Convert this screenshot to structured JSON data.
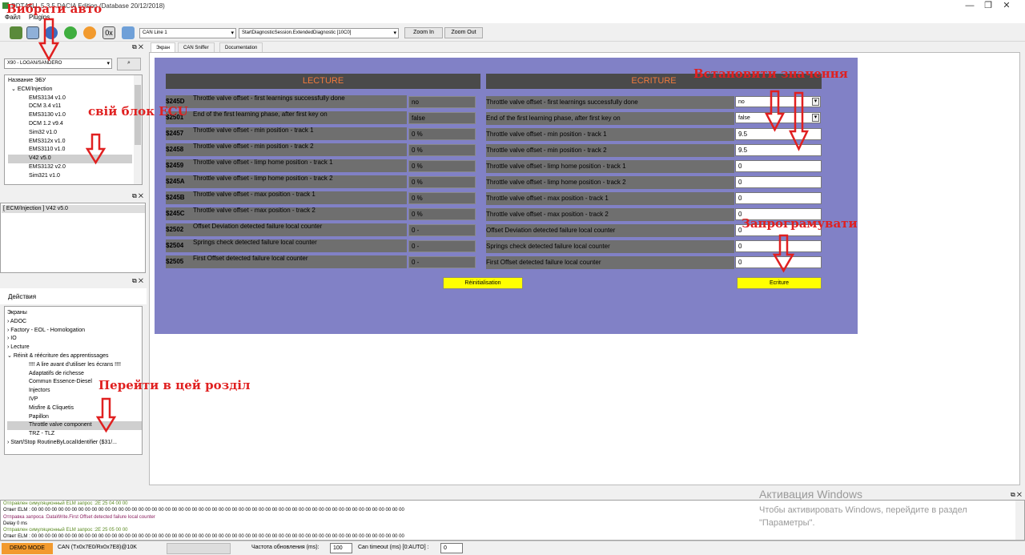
{
  "window": {
    "title": "DDT4ALL 5.3.5 DACIA Edition (Database 20/12/2018)",
    "min": "—",
    "max": "❐",
    "close": "✕"
  },
  "menu": {
    "file": "Файл",
    "plugins": "Plugins"
  },
  "toolbar": {
    "zero_x": "0x",
    "can_line": "CAN Line 1",
    "session": "StartDiagnosticSession.ExtendedDiagnostic [10C0]",
    "zoom_in": "Zoom In",
    "zoom_out": "Zoom Out"
  },
  "vehicle": {
    "selected": "X90 - LOGAN/SANDERO",
    "search_icon": "search-icon"
  },
  "ecu_tree": {
    "header": "Название ЭБУ",
    "group": "ECM/Injection",
    "items": [
      "EMS3134 v1.0",
      "DCM 3.4 v11",
      "EMS3130 v1.0",
      "DCM 1.2 v9.4",
      "Sim32 v1.0",
      "EMS312x v1.0",
      "EMS3110 v1.0",
      "V42 v5.0",
      "EMS3132 v2.0",
      "Sim321 v1.0"
    ],
    "selected": "V42 v5.0"
  },
  "ecu_selected_panel": {
    "item": "[ ECM/Injection ] V42 v5.0"
  },
  "actions": {
    "title": "Действия",
    "root": "Экраны",
    "items": [
      "ADOC",
      "Factory - EOL - Homologation",
      "IO",
      "Lecture",
      "Réinit & réécriture des apprentissages"
    ],
    "subitems": [
      "!!!! A lire avant d'utiliser les écrans !!!!",
      "Adaptatifs de richesse",
      "Commun Essence-Diesel",
      "Injectors",
      "IVP",
      "Misfire & Cliquetis",
      "Papillon",
      "Throttle valve component",
      "TRZ - TLZ"
    ],
    "last": "Start/Stop RoutineByLocalIdentifier ($31/...",
    "selected": "Throttle valve component"
  },
  "tabs": [
    "Экран",
    "CAN Sniffer",
    "Documentation"
  ],
  "lecture": {
    "title": "LECTURE",
    "rows": [
      {
        "code": "$245D",
        "label": "Throttle valve offset - first learnings successfully done",
        "value": "no"
      },
      {
        "code": "$2501",
        "label": "End of the first learning phase, after first key on",
        "value": "false"
      },
      {
        "code": "$2457",
        "label": "Throttle valve offset - min position - track 1",
        "value": "0 %"
      },
      {
        "code": "$2458",
        "label": "Throttle valve offset - min position - track 2",
        "value": "0 %"
      },
      {
        "code": "$2459",
        "label": "Throttle valve offset - limp home position - track 1",
        "value": "0 %"
      },
      {
        "code": "$245A",
        "label": "Throttle valve offset - limp home position - track 2",
        "value": "0 %"
      },
      {
        "code": "$245B",
        "label": "Throttle valve offset - max position - track 1",
        "value": "0 %"
      },
      {
        "code": "$245C",
        "label": "Throttle valve offset - max position - track 2",
        "value": "0 %"
      },
      {
        "code": "$2502",
        "label": "Offset Deviation detected failure local counter",
        "value": "0 -"
      },
      {
        "code": "$2504",
        "label": "Springs check detected failure local counter",
        "value": "0 -"
      },
      {
        "code": "$2505",
        "label": "First Offset detected failure local counter",
        "value": "0 -"
      }
    ],
    "button": "Réinitialisation"
  },
  "ecriture": {
    "title": "ECRITURE",
    "rows": [
      {
        "label": "Throttle valve offset - first learnings successfully done",
        "value": "no"
      },
      {
        "label": "End of the first learning phase, after first key on",
        "value": "false"
      },
      {
        "label": "Throttle valve offset - min position - track 1",
        "value": "9.5"
      },
      {
        "label": "Throttle valve offset - min position - track 2",
        "value": "9.5"
      },
      {
        "label": "Throttle valve offset - limp home position - track 1",
        "value": "0"
      },
      {
        "label": "Throttle valve offset - limp home position - track 2",
        "value": "0"
      },
      {
        "label": "Throttle valve offset - max position - track 1",
        "value": "0"
      },
      {
        "label": "Throttle valve offset - max position - track 2",
        "value": "0"
      },
      {
        "label": "Offset Deviation detected failure local counter",
        "value": "0"
      },
      {
        "label": "Springs check detected failure local counter",
        "value": "0"
      },
      {
        "label": "First Offset detected failure local counter",
        "value": "0"
      }
    ],
    "button": "Ecriture"
  },
  "annotations": {
    "choose_car": "Вибрати авто",
    "your_ecu": "свій блок ECU",
    "go_section": "Перейти в цей розділ",
    "set_values": "Встановити значення",
    "program": "Запрограмувати"
  },
  "log": {
    "lines": [
      "Отправлен симуляционный ELM запрос :2E 25 04 00 00",
      "Ответ ELM : 00 00 00 00 00 00 00 00 00 00 00 00 00 00 00 00 00 00 00 00 00 00 00 00 00 00 00 00 00 00 00 00 00 00 00 00 00 00 00 00 00 00 00 00 00 00 00 00 00 00 00 00 00 00 00 00",
      "Отправка запроса :DataWrite.First Offset detected failure local counter",
      "Delay 0 ms",
      "Отправлен симуляционный ELM запрос :2E 25 05 00 00",
      "Ответ ELM : 00 00 00 00 00 00 00 00 00 00 00 00 00 00 00 00 00 00 00 00 00 00 00 00 00 00 00 00 00 00 00 00 00 00 00 00 00 00 00 00 00 00 00 00 00 00 00 00 00 00 00 00 00 00 00 00"
    ]
  },
  "watermark": {
    "line1": "Активация Windows",
    "line2": "Чтобы активировать Windows, перейдите в раздел",
    "line3": "\"Параметры\"."
  },
  "status": {
    "mode": "DEMO MODE",
    "can": "CAN (Tx0x7E0/Rx0x7E8)@10K",
    "refresh_label": "Частота обновления (ms):",
    "refresh_value": "100",
    "timeout_label": "Can timeout (ms) [0:AUTO] :",
    "timeout_value": "0"
  },
  "colors": {
    "violet": "#8181c6",
    "header_orange": "#f07a3c",
    "yellow_button": "#ffff00",
    "annotation_red": "#e02020"
  }
}
